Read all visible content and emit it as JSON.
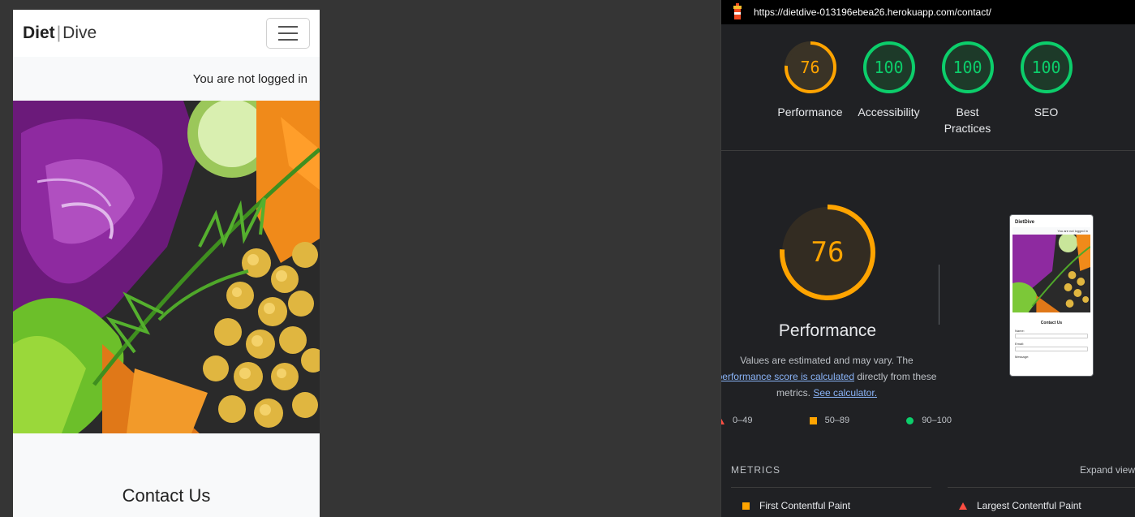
{
  "mobile": {
    "brand_part1": "Diet",
    "brand_separator": "|",
    "brand_part2": "Dive",
    "login_status": "You are not logged in",
    "contact_title": "Contact Us"
  },
  "lighthouse": {
    "url": "https://dietdive-013196ebea26.herokuapp.com/contact/",
    "scores": [
      {
        "label": "Performance",
        "value": "76",
        "color": "#ffa400",
        "fraction": 0.76
      },
      {
        "label": "Accessibility",
        "value": "100",
        "color": "#0cce6b",
        "fraction": 1.0
      },
      {
        "label": "Best Practices",
        "value": "100",
        "color": "#0cce6b",
        "fraction": 1.0
      },
      {
        "label": "SEO",
        "value": "100",
        "color": "#0cce6b",
        "fraction": 1.0
      }
    ],
    "performance": {
      "value": "76",
      "title": "Performance",
      "desc_part1": "Values are estimated and may vary. The ",
      "desc_link1": "performance score is calculated",
      "desc_part2": " directly from these metrics. ",
      "desc_link2": "See calculator."
    },
    "legend": {
      "fail": "0–49",
      "average": "50–89",
      "pass": "90–100"
    },
    "thumbnail": {
      "brand": "DietDive",
      "login": "You are not logged in",
      "contact": "Contact Us",
      "field1": "Name:",
      "field2": "Email:",
      "field3": "Message:"
    },
    "metrics_heading": "METRICS",
    "expand_label": "Expand view",
    "metrics": [
      {
        "label": "First Contentful Paint",
        "status": "average"
      },
      {
        "label": "Largest Contentful Paint",
        "status": "fail"
      }
    ],
    "colors": {
      "pass": "#0cce6b",
      "average": "#ffa400",
      "fail": "#ff4e42"
    }
  }
}
